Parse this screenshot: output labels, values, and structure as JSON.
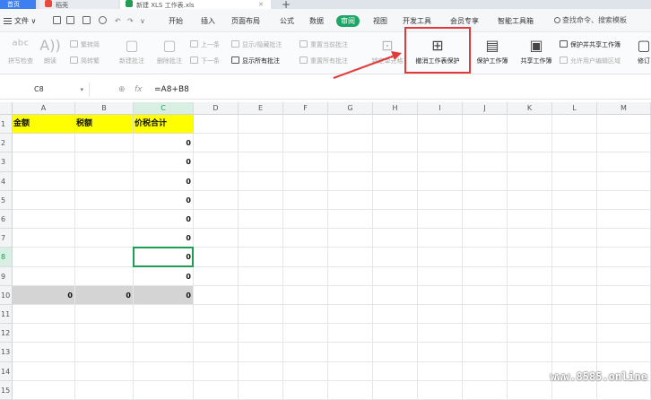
{
  "tabs": [
    {
      "label": "首页"
    },
    {
      "label": "稻壳"
    },
    {
      "label": "新建 XLS 工作表.xls"
    }
  ],
  "menu": {
    "file": "文件",
    "items": [
      "开始",
      "插入",
      "页面布局",
      "公式",
      "数据",
      "审阅",
      "视图",
      "开发工具",
      "会员专享",
      "智能工具箱"
    ],
    "search": "查找命令、搜索模板"
  },
  "ribbon": {
    "spellcheck": "拼写检查",
    "read": "朗读",
    "trad_to_simp": "繁转简",
    "simp_to_trad": "简转繁",
    "new_comment": "新建批注",
    "delete_comment": "删除批注",
    "prev": "上一条",
    "next": "下一条",
    "show_hide_comment": "显示/隐藏批注",
    "show_all_comments": "显示所有批注",
    "reset_current_comment": "重置当前批注",
    "reset_all_comments": "重置所有批注",
    "lock_cell": "锁定单元格",
    "unprotect_sheet": "撤消工作表保护",
    "protect_workbook": "保护工作簿",
    "share_workbook": "共享工作簿",
    "protect_share_workbook": "保护并共享工作簿",
    "allow_edit_ranges": "允许用户编辑区域",
    "track_changes": "修订"
  },
  "formula_bar": {
    "name_box": "C8",
    "fx": "fx",
    "formula": "=A8+B8"
  },
  "sheet": {
    "columns": [
      "A",
      "B",
      "C",
      "D",
      "E",
      "F",
      "G",
      "H",
      "I",
      "J",
      "K",
      "L",
      "M"
    ],
    "rows": [
      "1",
      "2",
      "3",
      "4",
      "5",
      "6",
      "7",
      "8",
      "9",
      "10",
      "11",
      "12",
      "13",
      "14",
      "15"
    ],
    "headers": [
      "金额",
      "税额",
      "价税合计"
    ],
    "c_values": [
      "0",
      "0",
      "0",
      "0",
      "0",
      "0",
      "0",
      "0"
    ],
    "total_row": [
      "0",
      "0",
      "0"
    ]
  },
  "watermark": "www.8585.online",
  "colors": {
    "review_tab": "#1fa566",
    "header_fill": "#ffff00",
    "total_fill": "#d4d4d4",
    "highlight": "#e03a3a",
    "active_cell": "#1f9d55"
  }
}
